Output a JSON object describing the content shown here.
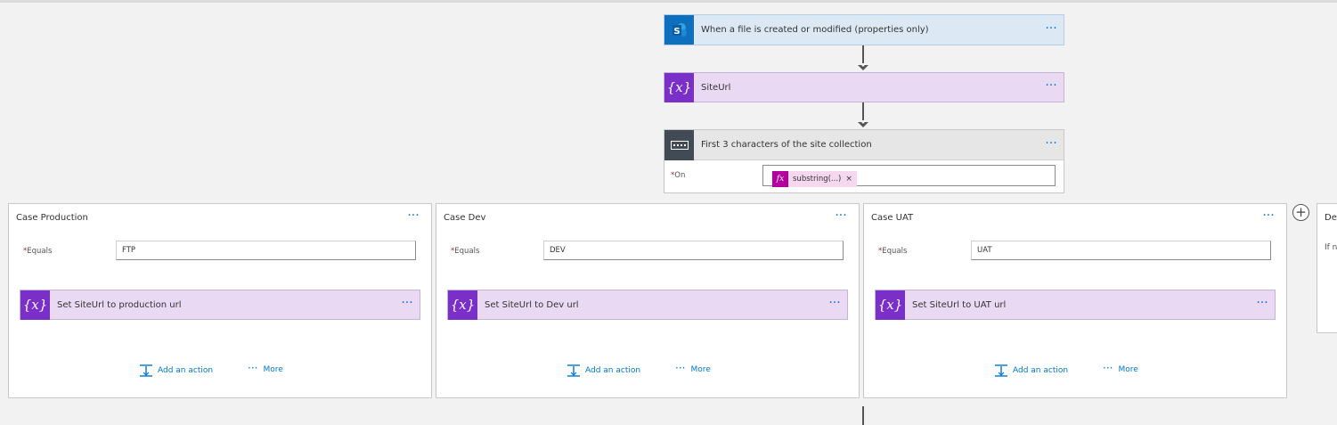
{
  "trigger": {
    "title": "When a file is created or modified (properties only)",
    "icon": "sharepoint-icon",
    "more": "···"
  },
  "siteurl": {
    "title": "SiteUrl",
    "icon": "variable-icon",
    "more": "···"
  },
  "switch": {
    "title": "First 3 characters of the site collection",
    "icon": "switch-icon",
    "more": "···",
    "on_required": "*",
    "on_label": "On",
    "token_badge": "fx",
    "token_text": "substring(...)",
    "token_remove": "×"
  },
  "cases": [
    {
      "title": "Case Production",
      "equals_label": "Equals",
      "equals_value": "FTP",
      "action_title": "Set SiteUrl to production url"
    },
    {
      "title": "Case Dev",
      "equals_label": "Equals",
      "equals_value": "DEV",
      "action_title": "Set SiteUrl to Dev url"
    },
    {
      "title": "Case UAT",
      "equals_label": "Equals",
      "equals_value": "UAT",
      "action_title": "Set SiteUrl to UAT url"
    }
  ],
  "case_common": {
    "required": "*",
    "more": "···",
    "add_action": "Add an action",
    "more_label": "More",
    "more_dots": "···",
    "var_symbol": "{x}"
  },
  "add_case": "+",
  "default_case": {
    "title": "Def",
    "subtitle": "If n"
  },
  "colors": {
    "sharepoint": "#0f6fbf",
    "variable": "#7a2fc8",
    "switch": "#424a55",
    "expression": "#b4009e",
    "link": "#0078d4"
  }
}
